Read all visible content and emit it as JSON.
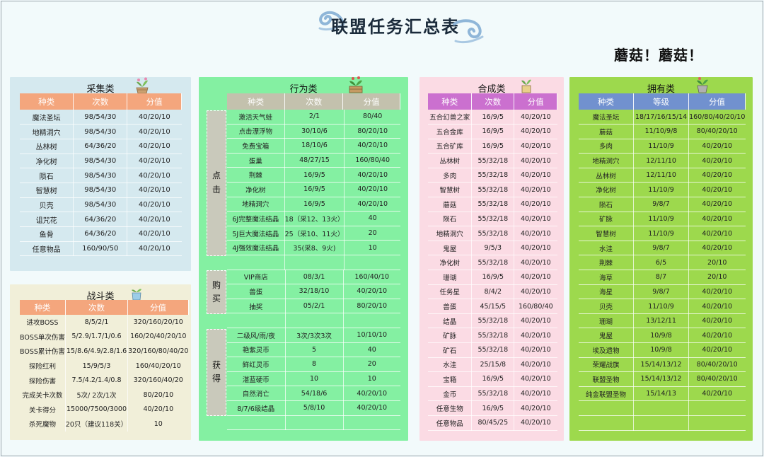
{
  "title": "联盟任务汇总表",
  "slogan": "蘑菇！蘑菇！",
  "colors": {
    "collect_bg": "#d5e9ef",
    "collect_header": "#f4a67d",
    "battle_bg": "#f1efd9",
    "battle_header": "#f4a67d",
    "behavior_bg": "#84f0a2",
    "behavior_header": "#c3c1ad",
    "craft_bg": "#fbdbe4",
    "craft_header": "#cb70cf",
    "own_bg": "#9dd94d",
    "own_header": "#7191cf"
  },
  "collect": {
    "title": "采集类",
    "headers": [
      "种类",
      "次数",
      "分值"
    ],
    "rows": [
      [
        "魔法圣坛",
        "98/54/30",
        "40/20/10"
      ],
      [
        "地精洞穴",
        "98/54/30",
        "40/20/10"
      ],
      [
        "丛林树",
        "64/36/20",
        "40/20/10"
      ],
      [
        "净化树",
        "98/54/30",
        "40/20/10"
      ],
      [
        "陨石",
        "98/54/30",
        "40/20/10"
      ],
      [
        "智慧树",
        "98/54/30",
        "40/20/10"
      ],
      [
        "贝壳",
        "98/54/30",
        "40/20/10"
      ],
      [
        "诅咒花",
        "64/36/20",
        "40/20/10"
      ],
      [
        "鱼骨",
        "64/36/20",
        "40/20/10"
      ],
      [
        "任意物品",
        "160/90/50",
        "40/20/10"
      ]
    ]
  },
  "battle": {
    "title": "战斗类",
    "headers": [
      "种类",
      "次数",
      "分值"
    ],
    "rows": [
      [
        "进攻BOSS",
        "8/5/2/1",
        "320/160/20/10"
      ],
      [
        "BOSS单次伤害",
        "5/2.9/1.7/1/0.6",
        "160/20/40/20/10"
      ],
      [
        "BOSS累计伤害",
        "15/8.6/4.9/2.8/1.6",
        "320/160/80/40/20"
      ],
      [
        "探险红利",
        "15/9/5/3",
        "160/40/20/10"
      ],
      [
        "探险伤害",
        "7.5/4.2/1.4/0.8",
        "320/160/40/20"
      ],
      [
        "完成关卡次数",
        "5次/ 2次/1次",
        "80/20/10"
      ],
      [
        "关卡得分",
        "15000/7500/3000",
        "40/20/10"
      ],
      [
        "杀死魔物",
        "20只（建议118关）",
        "10"
      ]
    ]
  },
  "behavior": {
    "title": "行为类",
    "headers": [
      "种类",
      "次数",
      "分值"
    ],
    "groups": [
      {
        "label": "点\n击",
        "rows": [
          [
            "激活天气蛙",
            "2/1",
            "80/40"
          ],
          [
            "点击漂浮物",
            "30/10/6",
            "80/20/10"
          ],
          [
            "免费宝箱",
            "18/10/6",
            "40/20/10"
          ],
          [
            "蛋巢",
            "48/27/15",
            "160/80/40"
          ],
          [
            "荆棘",
            "16/9/5",
            "40/20/10"
          ],
          [
            "净化树",
            "16/9/5",
            "40/20/10"
          ],
          [
            "地精洞穴",
            "16/9/5",
            "40/20/10"
          ],
          [
            "6J完整魔法结晶",
            "18（采12、13火）",
            "40"
          ],
          [
            "5J巨大魔法结晶",
            "25（采10、11火）",
            "20"
          ],
          [
            "4J强效魔法结晶",
            "35(采8、9火)",
            "10"
          ],
          [
            "",
            "",
            ""
          ]
        ]
      },
      {
        "label": "购\n买",
        "rows": [
          [
            "VIP商店",
            "08/3/1",
            "160/40/10"
          ],
          [
            "兽蛋",
            "32/18/10",
            "40/20/10"
          ],
          [
            "抽奖",
            "05/2/1",
            "80/20/10"
          ],
          [
            "",
            "",
            ""
          ]
        ]
      },
      {
        "label": "获\n得",
        "rows": [
          [
            "二级风/雨/夜",
            "3次/3次3次",
            "10/10/10"
          ],
          [
            "艳紫灵币",
            "5",
            "40"
          ],
          [
            "鲜红灵币",
            "8",
            "20"
          ],
          [
            "湛蓝硬币",
            "10",
            "10"
          ],
          [
            "自然消亡",
            "54/18/6",
            "40/20/10"
          ],
          [
            "8/7/6级结晶",
            "5/8/10",
            "40/20/10"
          ],
          [
            "",
            "",
            ""
          ]
        ]
      }
    ]
  },
  "craft": {
    "title": "合成类",
    "headers": [
      "种类",
      "次数",
      "分值"
    ],
    "rows": [
      [
        "五合幻兽之家",
        "16/9/5",
        "40/20/10"
      ],
      [
        "五合金库",
        "16/9/5",
        "40/20/10"
      ],
      [
        "五合矿库",
        "16/9/5",
        "40/20/10"
      ],
      [
        "丛林树",
        "55/32/18",
        "40/20/10"
      ],
      [
        "多肉",
        "55/32/18",
        "40/20/10"
      ],
      [
        "智慧树",
        "55/32/18",
        "40/20/10"
      ],
      [
        "蘑菇",
        "55/32/18",
        "40/20/10"
      ],
      [
        "陨石",
        "55/32/18",
        "40/20/10"
      ],
      [
        "地精洞穴",
        "55/32/18",
        "40/20/10"
      ],
      [
        "鬼屋",
        "9/5/3",
        "40/20/10"
      ],
      [
        "净化树",
        "55/32/18",
        "40/20/10"
      ],
      [
        "珊瑚",
        "16/9/5",
        "40/20/10"
      ],
      [
        "任务星",
        "8/4/2",
        "40/20/10"
      ],
      [
        "兽蛋",
        "45/15/5",
        "160/80/40"
      ],
      [
        "结晶",
        "55/32/18",
        "40/20/10"
      ],
      [
        "矿脉",
        "55/32/18",
        "40/20/10"
      ],
      [
        "矿石",
        "55/32/18",
        "40/20/10"
      ],
      [
        "水洼",
        "25/15/8",
        "40/20/10"
      ],
      [
        "宝箱",
        "16/9/5",
        "40/20/10"
      ],
      [
        "金币",
        "55/32/18",
        "40/20/10"
      ],
      [
        "任意生物",
        "16/9/5",
        "40/20/10"
      ],
      [
        "任意物品",
        "80/45/25",
        "40/20/10"
      ]
    ]
  },
  "own": {
    "title": "拥有类",
    "headers": [
      "种类",
      "等级",
      "分值"
    ],
    "rows": [
      [
        "魔法圣坛",
        "18/17/16/15/14",
        "160/80/40/20/10"
      ],
      [
        "蘑菇",
        "11/10/9/8",
        "80/40/20/10"
      ],
      [
        "多肉",
        "11/10/9",
        "40/20/10"
      ],
      [
        "地精洞穴",
        "12/11/10",
        "40/20/10"
      ],
      [
        "丛林树",
        "12/11/10",
        "40/20/10"
      ],
      [
        "净化树",
        "11/10/9",
        "40/20/10"
      ],
      [
        "陨石",
        "9/8/7",
        "40/20/10"
      ],
      [
        "矿脉",
        "11/10/9",
        "40/20/10"
      ],
      [
        "智慧树",
        "11/10/9",
        "40/20/10"
      ],
      [
        "水洼",
        "9/8/7",
        "40/20/10"
      ],
      [
        "荆棘",
        "6/5",
        "20/10"
      ],
      [
        "海草",
        "8/7",
        "20/10"
      ],
      [
        "海星",
        "9/8/7",
        "40/20/10"
      ],
      [
        "贝壳",
        "11/10/9",
        "40/20/10"
      ],
      [
        "珊瑚",
        "13/12/11",
        "40/20/10"
      ],
      [
        "鬼屋",
        "10/9/8",
        "40/20/10"
      ],
      [
        "埃及遗物",
        "10/9/8",
        "40/20/10"
      ],
      [
        "荣耀战旗",
        "15/14/13/12",
        "80/40/20/10"
      ],
      [
        "联盟圣物",
        "15/14/13/12",
        "80/40/20/10"
      ],
      [
        "纯金联盟圣物",
        "15/14/13",
        "40/20/10"
      ],
      [
        "",
        "",
        ""
      ],
      [
        "",
        "",
        ""
      ]
    ]
  }
}
